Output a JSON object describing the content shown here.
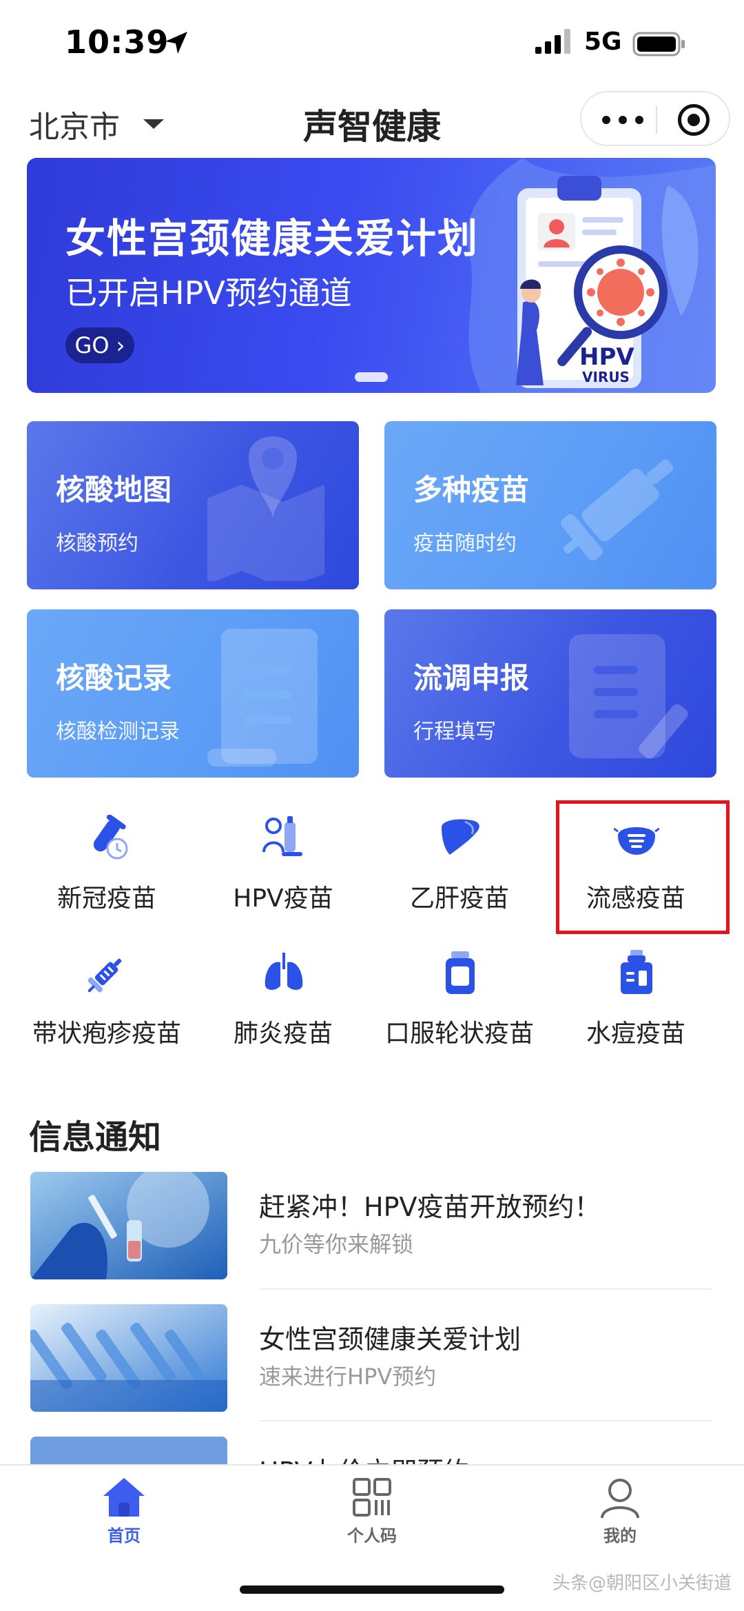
{
  "status_bar": {
    "time": "10:39",
    "network": "5G"
  },
  "nav": {
    "city": "北京市",
    "title": "声智健康"
  },
  "banner": {
    "title": "女性宫颈健康关爱计划",
    "subtitle": "已开启HPV预约通道",
    "go_label": "GO ›",
    "art_text_1": "HPV",
    "art_text_2": "VIRUS"
  },
  "cards": [
    {
      "title": "核酸地图",
      "subtitle": "核酸预约",
      "icon": "map-pin-icon"
    },
    {
      "title": "多种疫苗",
      "subtitle": "疫苗随时约",
      "icon": "syringe-icon"
    },
    {
      "title": "核酸记录",
      "subtitle": "核酸检测记录",
      "icon": "scroll-icon"
    },
    {
      "title": "流调申报",
      "subtitle": "行程填写",
      "icon": "document-edit-icon"
    }
  ],
  "vaccines": [
    {
      "label": "新冠疫苗",
      "icon": "test-tube-clock-icon"
    },
    {
      "label": "HPV疫苗",
      "icon": "lab-person-icon"
    },
    {
      "label": "乙肝疫苗",
      "icon": "liver-icon"
    },
    {
      "label": "流感疫苗",
      "icon": "mask-icon"
    },
    {
      "label": "带状疱疹疫苗",
      "icon": "syringe-icon"
    },
    {
      "label": "肺炎疫苗",
      "icon": "lungs-icon"
    },
    {
      "label": "口服轮状疫苗",
      "icon": "bottle-icon"
    },
    {
      "label": "水痘疫苗",
      "icon": "vial-icon"
    }
  ],
  "info": {
    "title": "信息通知",
    "items": [
      {
        "title": "赶紧冲！HPV疫苗开放预约！",
        "subtitle": "九价等你来解锁"
      },
      {
        "title": "女性宫颈健康关爱计划",
        "subtitle": "速来进行HPV预约"
      },
      {
        "title": "HPV九价立即预约",
        "subtitle": ""
      }
    ]
  },
  "tabs": [
    {
      "label": "首页",
      "icon": "home-icon",
      "active": true
    },
    {
      "label": "个人码",
      "icon": "qr-code-icon",
      "active": false
    },
    {
      "label": "我的",
      "icon": "user-icon",
      "active": false
    }
  ],
  "watermark": "头条@朝阳区小关街道",
  "colors": {
    "accent": "#3d5cf0",
    "highlight": "#e8121a",
    "tab_inactive": "#666666"
  }
}
